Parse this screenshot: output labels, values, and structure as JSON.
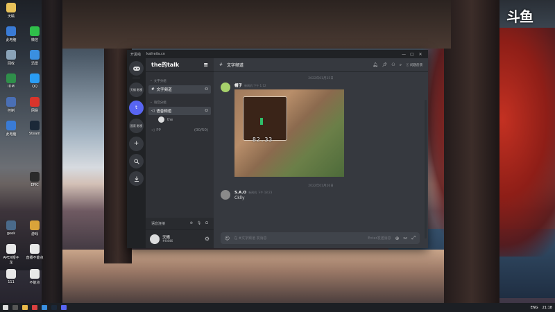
{
  "watermark": "斗鱼",
  "desktop_icons": [
    {
      "label": "天睛",
      "color": "#e8c25a"
    },
    {
      "label": "此电脑",
      "color": "#3a7bd5"
    },
    {
      "label": "回收",
      "color": "#8aa3b8"
    },
    {
      "label": "IDM",
      "color": "#2f8f4a"
    },
    {
      "label": "控制",
      "color": "#4a6fb5"
    },
    {
      "label": "此电脑",
      "color": "#3a7bd5"
    },
    {
      "label": "微信",
      "color": "#2fbf4a"
    },
    {
      "label": "迅雷",
      "color": "#3a8fe0"
    },
    {
      "label": "QQ",
      "color": "#2a9df4"
    },
    {
      "label": "网易",
      "color": "#d9342b"
    },
    {
      "label": "Steam",
      "color": "#1b2838"
    },
    {
      "label": "EPIC",
      "color": "#2a2a2a"
    },
    {
      "label": "geek",
      "color": "#4a6a8a"
    },
    {
      "label": "APEX帽子龙",
      "color": "#e8e8e8"
    },
    {
      "label": "111",
      "color": "#e8e8e8"
    },
    {
      "label": "游戏",
      "color": "#d9a33a"
    },
    {
      "label": "直播不能点",
      "color": "#e8e8e8"
    },
    {
      "label": "不能点",
      "color": "#e8e8e8"
    }
  ],
  "window": {
    "title_app": "开黑啦",
    "title_url": "kaiheila.cn",
    "min": "—",
    "max": "▢",
    "close": "✕"
  },
  "servers": [
    {
      "label": "天钢\n影视"
    },
    {
      "label": "t"
    },
    {
      "label": "国家\n影视"
    }
  ],
  "guild": {
    "name": "the的talk"
  },
  "categories": {
    "text": "文字分组",
    "voice": "语音分组"
  },
  "channels": {
    "text_channel": "文字频道",
    "voice_channel": "语音频道",
    "voice_user": "the",
    "pp_channel": "PP",
    "pp_count": "(00/50)"
  },
  "voice_status": "语音连接",
  "user": {
    "name": "天睛",
    "tag": "#0446"
  },
  "main": {
    "channel_name": "文字频道",
    "help_label": "问题反馈",
    "date1": "2022年01月25日",
    "date2": "2022年01月26日",
    "msg1_author": "帽子",
    "msg1_time": "新闻机 下午 1:12",
    "image_value": "82.33",
    "msg2_author": "S.A.O",
    "msg2_time": "新闻机 下午 18:23",
    "msg2_text": "Cklly",
    "composer_placeholder": "在 #文字频道 发消息",
    "composer_hint": "Enter发送消息"
  },
  "taskbar": {
    "lang": "ENG",
    "time": "21:18"
  }
}
